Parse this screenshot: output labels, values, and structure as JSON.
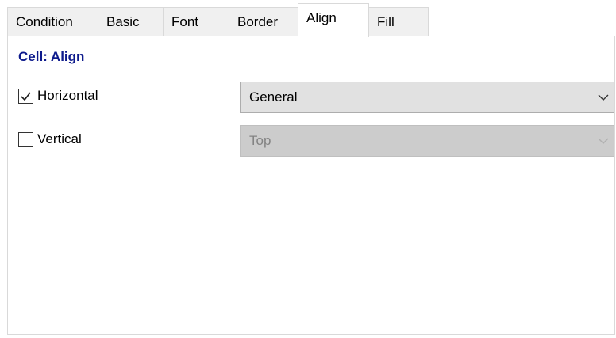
{
  "tabs": [
    {
      "label": "Condition",
      "active": false
    },
    {
      "label": "Basic",
      "active": false
    },
    {
      "label": "Font",
      "active": false
    },
    {
      "label": "Border",
      "active": false
    },
    {
      "label": "Align",
      "active": true
    },
    {
      "label": "Fill",
      "active": false
    }
  ],
  "section": {
    "title": "Cell: Align"
  },
  "rows": {
    "horizontal": {
      "label": "Horizontal",
      "checked": true,
      "value": "General",
      "enabled": true
    },
    "vertical": {
      "label": "Vertical",
      "checked": false,
      "value": "Top",
      "enabled": false
    }
  },
  "icons": {
    "checkmark": "check-icon",
    "dropdown": "chevron-down-icon"
  },
  "colors": {
    "section_title": "#0d1a8c",
    "combo_bg": "#e1e1e1",
    "combo_disabled_bg": "#cccccc",
    "disabled_text": "#838383"
  }
}
